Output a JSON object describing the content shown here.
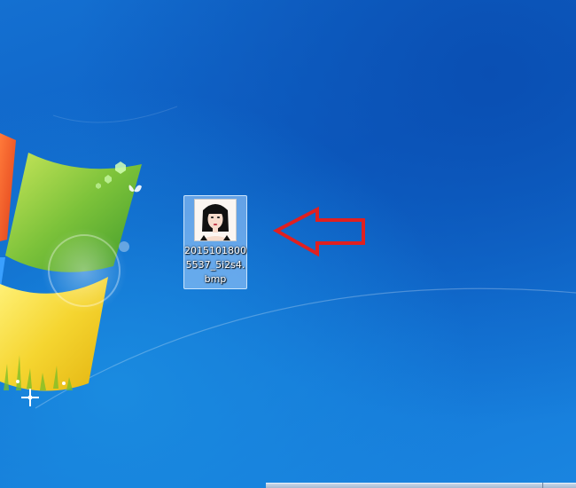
{
  "desktop": {
    "icon": {
      "name_line1": "2015101800",
      "name_line2": "5537_5i2s4.",
      "name_line3": "bmp",
      "thumbnail": "portrait-of-woman-with-black-hair"
    },
    "annotation": {
      "arrow_icon": "left-arrow-icon",
      "color": "#e02020"
    }
  },
  "colors": {
    "background": "#1470d1",
    "icon_selection": "#aad2ff"
  }
}
